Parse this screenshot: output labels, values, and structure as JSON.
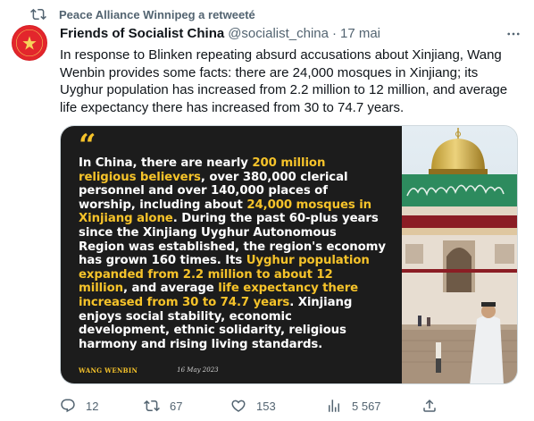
{
  "retweet": {
    "text": "Peace Alliance Winnipeg a retweeté"
  },
  "tweet": {
    "display_name": "Friends of Socialist China",
    "handle": "@socialist_china",
    "separator": "·",
    "time": "17 mai",
    "text": "In response to Blinken repeating absurd accusations about Xinjiang, Wang Wenbin provides some facts: there are 24,000 mosques in Xinjiang; its Uyghur population has increased from 2.2 million to 12 million, and average life expectancy there has increased from 30 to 74.7 years."
  },
  "card": {
    "quote_mark": "“",
    "segments": [
      {
        "text": "In China, there are nearly ",
        "hl": false
      },
      {
        "text": "200 million religious believers",
        "hl": true
      },
      {
        "text": ", over 380,000 clerical personnel and over 140,000 places of worship, including about ",
        "hl": false
      },
      {
        "text": "24,000 mosques in Xinjiang alone",
        "hl": true
      },
      {
        "text": ". During the past 60-plus years since the Xinjiang Uyghur Autonomous Region was established, the region's economy has grown 160 times. Its ",
        "hl": false
      },
      {
        "text": "Uyghur population expanded from 2.2 million to about 12 million",
        "hl": true
      },
      {
        "text": ", and average ",
        "hl": false
      },
      {
        "text": "life expectancy there increased from 30 to 74.7 years",
        "hl": true
      },
      {
        "text": ". Xinjiang enjoys social stability, economic development, ethnic solidarity, religious harmony and rising living standards.",
        "hl": false
      }
    ],
    "author": "WANG WENBIN",
    "date": "16 May 2023"
  },
  "actions": {
    "replies": "12",
    "retweets": "67",
    "likes": "153",
    "views": "5 567"
  },
  "icons": {
    "retweet": "retweet-icon",
    "more": "more-icon",
    "reply": "reply-icon",
    "like": "heart-icon",
    "views": "views-icon",
    "share": "share-icon"
  },
  "colors": {
    "highlight": "#f6c32a",
    "card_bg": "#1c1c1c",
    "muted": "#536471",
    "avatar_red": "#e3262c"
  }
}
